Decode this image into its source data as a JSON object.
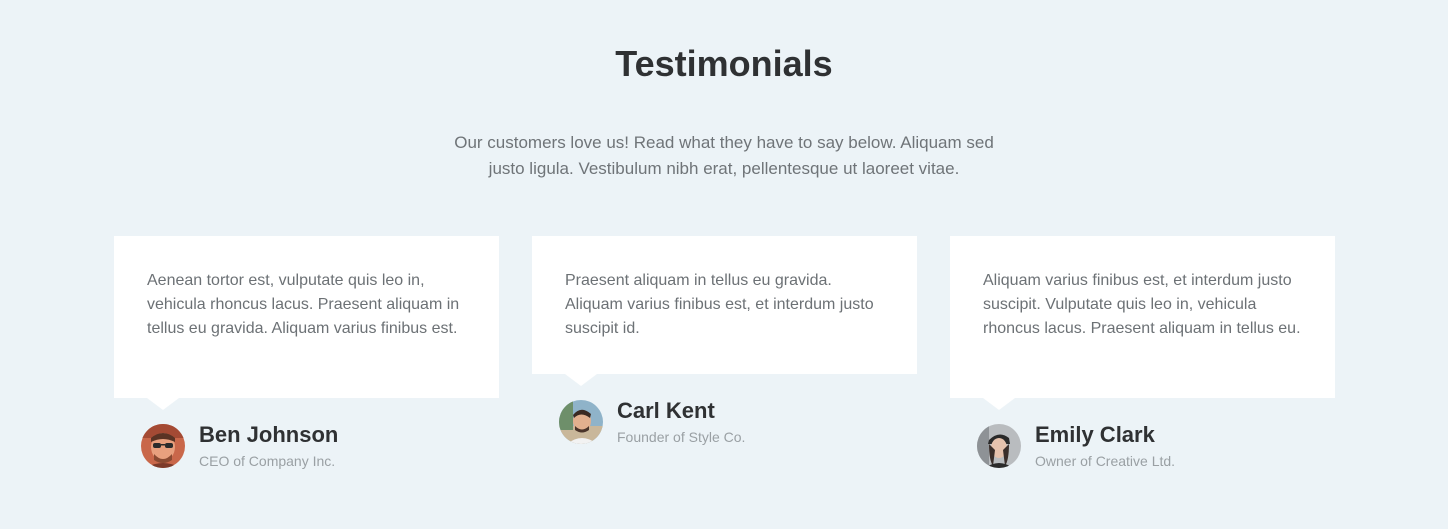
{
  "section": {
    "title": "Testimonials",
    "subtitle": "Our customers love us! Read what they have to say below. Aliquam sed justo ligula. Vestibulum nibh erat, pellentesque ut laoreet vitae."
  },
  "testimonials": [
    {
      "quote": "Aenean tortor est, vulputate quis leo in, vehicula rhoncus lacus. Praesent aliquam in tellus eu gravida. Aliquam varius finibus est.",
      "name": "Ben Johnson",
      "role": "CEO of Company Inc.",
      "avatar_icon": "man-with-sunglasses-avatar"
    },
    {
      "quote": "Praesent aliquam in tellus eu gravida. Aliquam varius finibus est, et interdum justo suscipit id.",
      "name": "Carl Kent",
      "role": "Founder of Style Co.",
      "avatar_icon": "man-outdoors-avatar"
    },
    {
      "quote": "Aliquam varius finibus est, et interdum justo suscipit. Vulputate quis leo in, vehicula rhoncus lacus. Praesent aliquam in tellus eu.",
      "name": "Emily Clark",
      "role": "Owner of Creative Ltd.",
      "avatar_icon": "woman-with-hat-avatar"
    }
  ],
  "colors": {
    "background": "#ecf3f7",
    "card": "#ffffff",
    "heading": "#2f3133",
    "body_text": "#6c7175",
    "muted_text": "#9aa0a4"
  }
}
